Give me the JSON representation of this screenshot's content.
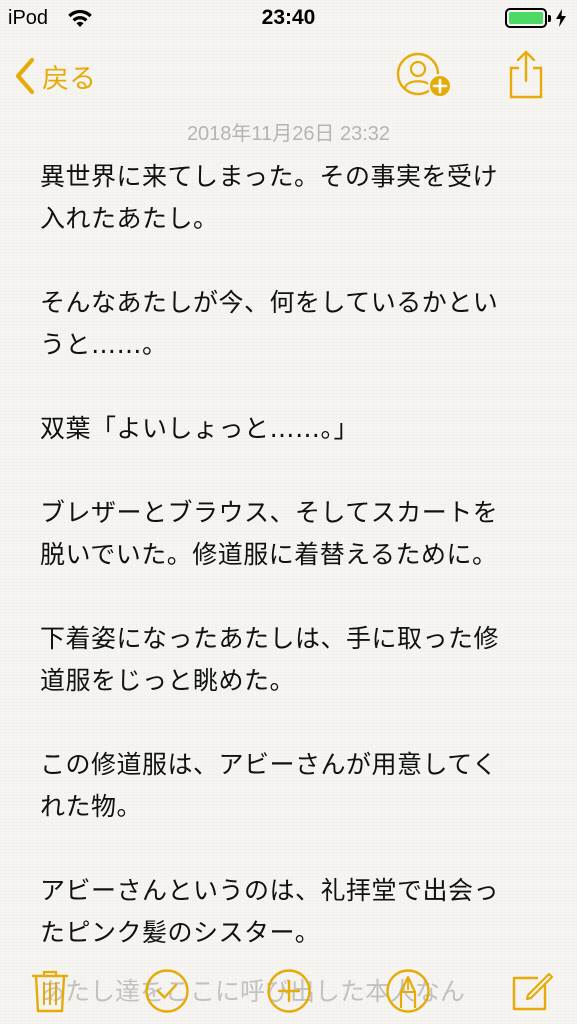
{
  "status_bar": {
    "carrier": "iPod",
    "time": "23:40",
    "battery_level": 1.0,
    "charging": true
  },
  "nav": {
    "back_label": "戻る"
  },
  "note": {
    "date": "2018年11月26日 23:32",
    "paragraphs": [
      [
        "異世界に来てしまった。その事実を受け",
        "入れたあたし。"
      ],
      [
        "そんなあたしが今、何をしているかとい",
        "うと……。"
      ],
      [
        "双葉「よいしょっと……。」"
      ],
      [
        "ブレザーとブラウス、そしてスカートを",
        "脱いでいた。修道服に着替えるために。"
      ],
      [
        "下着姿になったあたしは、手に取った修",
        "道服をじっと眺めた。"
      ],
      [
        "この修道服は、アビーさんが用意してく",
        "れた物。"
      ],
      [
        "アビーさんというのは、礼拝堂で出会っ",
        "たピンク髪のシスター。"
      ]
    ],
    "cutoff_text": "あたし達をここに呼び出した本人なん"
  },
  "colors": {
    "accent": "#e6ab09",
    "battery": "#4cd964",
    "background": "#f6f5f1",
    "date_text": "#b4b4b4"
  },
  "icons": {
    "back": "chevron-left-icon",
    "add_people": "add-people-icon",
    "share": "share-icon",
    "trash": "trash-icon",
    "checklist": "checklist-icon",
    "add": "add-icon",
    "markup": "markup-pen-icon",
    "compose": "compose-icon"
  }
}
